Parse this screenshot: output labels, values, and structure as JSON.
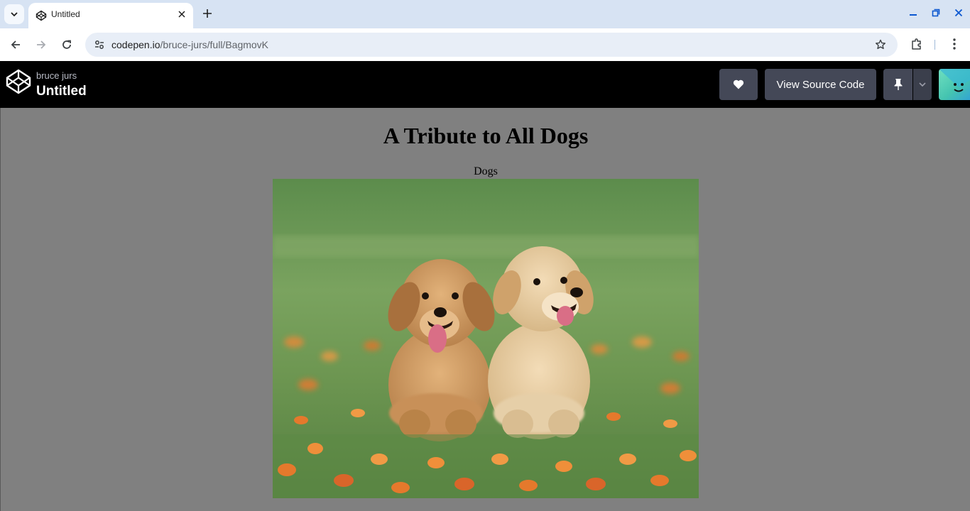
{
  "browser": {
    "tab": {
      "title": "Untitled"
    },
    "url": {
      "host": "codepen.io",
      "path": "/bruce-jurs/full/BagmovK"
    }
  },
  "codepen": {
    "author": "bruce jurs",
    "title": "Untitled",
    "view_source_label": "View Source Code"
  },
  "page": {
    "heading": "A Tribute to All Dogs",
    "caption": "Dogs"
  },
  "colors": {
    "header_bg": "#000000",
    "button_bg": "#444857",
    "page_bg": "#808080",
    "tabstrip_bg": "#d7e3f3"
  },
  "icons": [
    "search-tabs-icon",
    "codepen-icon",
    "close-icon",
    "plus-icon",
    "minimize-icon",
    "restore-icon",
    "back-arrow-icon",
    "forward-arrow-icon",
    "reload-icon",
    "site-settings-icon",
    "star-icon",
    "extensions-icon",
    "more-vert-icon",
    "heart-icon",
    "pin-icon",
    "chevron-down-icon"
  ]
}
